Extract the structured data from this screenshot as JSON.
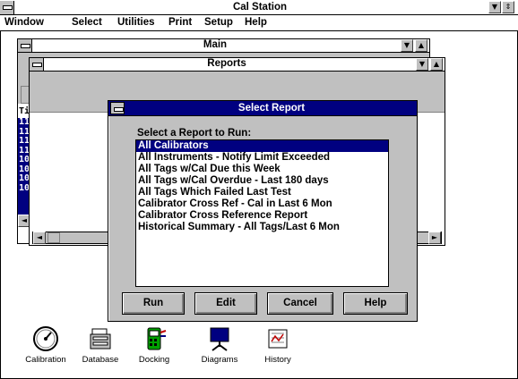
{
  "app": {
    "title": "Cal Station",
    "menu": [
      "Window",
      "Select",
      "Utilities",
      "Print",
      "Setup",
      "Help"
    ]
  },
  "main_window": {
    "title": "Main",
    "column_prefix": "Ti",
    "row_fragments": [
      "11",
      "11",
      "11",
      "11",
      "10",
      "10",
      "10",
      "10"
    ]
  },
  "reports_window": {
    "title": "Reports"
  },
  "dialog": {
    "title": "Select Report",
    "prompt": "Select a Report to Run:",
    "reports": [
      "All Calibrators",
      "All Instruments - Notify Limit Exceeded",
      "All Tags w/Cal Due this Week",
      "All Tags w/Cal Overdue - Last 180 days",
      "All Tags Which Failed Last Test",
      "Calibrator Cross Ref - Cal in Last 6 Mon",
      "Calibrator Cross Reference Report",
      "Historical Summary - All Tags/Last 6 Mon"
    ],
    "selected_index": 0,
    "buttons": {
      "run": "Run",
      "edit": "Edit",
      "cancel": "Cancel",
      "help": "Help"
    }
  },
  "desktop_icons": [
    {
      "label": "Calibration",
      "icon": "calibration-gauge-icon"
    },
    {
      "label": "Database",
      "icon": "database-icon"
    },
    {
      "label": "Docking",
      "icon": "docking-icon"
    },
    {
      "label": "Diagrams",
      "icon": "diagrams-icon"
    },
    {
      "label": "History",
      "icon": "history-icon"
    }
  ],
  "colors": {
    "dialog_titlebar": "#000080",
    "selection": "#000080",
    "chrome": "#c0c0c0"
  }
}
